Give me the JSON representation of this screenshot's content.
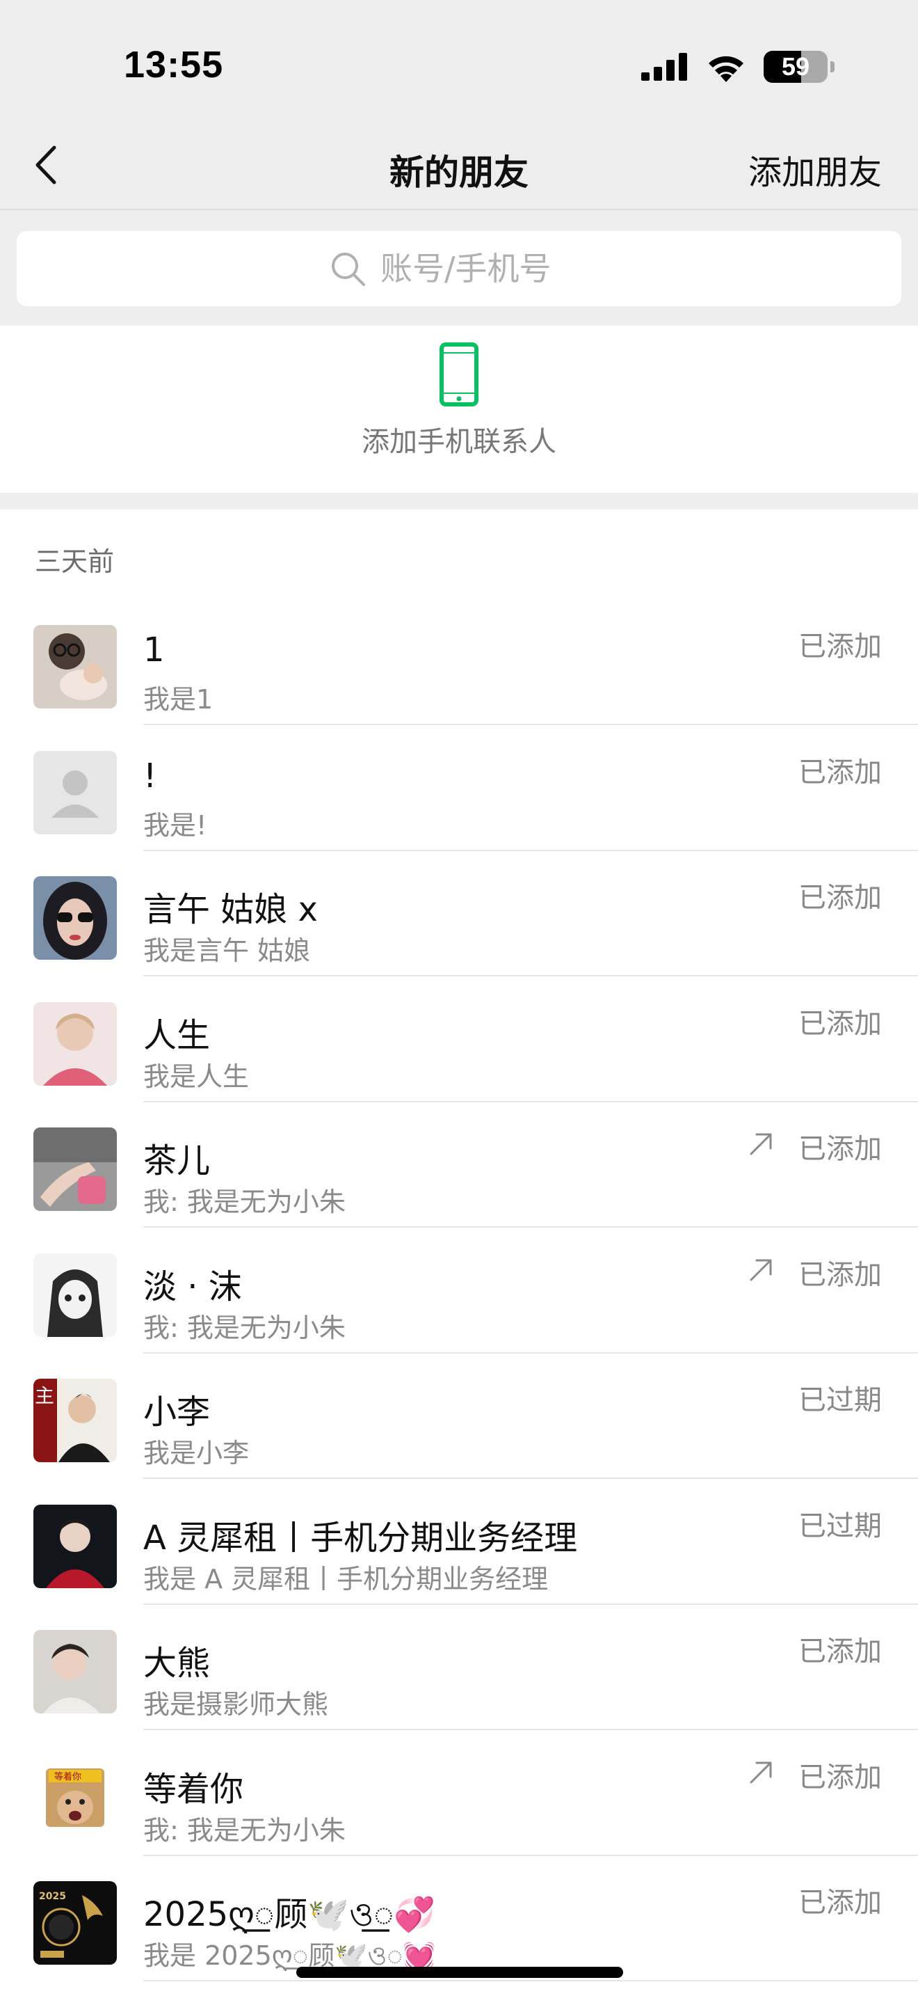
{
  "status_bar": {
    "time": "13:55",
    "battery_level": "59"
  },
  "nav": {
    "title": "新的朋友",
    "action": "添加朋友"
  },
  "search": {
    "placeholder": "账号/手机号"
  },
  "contacts_entry": {
    "label": "添加手机联系人"
  },
  "list": {
    "section_label": "三天前",
    "items": [
      {
        "name": "1",
        "message": "我是1",
        "status": "已添加",
        "shared": false,
        "avatar": "photo-person-glasses"
      },
      {
        "name": "!",
        "message": "我是!",
        "status": "已添加",
        "shared": false,
        "avatar": "default-avatar"
      },
      {
        "name": "言午 姑娘 x",
        "message": "我是言午 姑娘",
        "status": "已添加",
        "shared": false,
        "avatar": "photo-woman-sunglasses"
      },
      {
        "name": "人生",
        "message": "我是人生",
        "status": "已添加",
        "shared": false,
        "avatar": "photo-woman-pink"
      },
      {
        "name": "茶儿",
        "message": "我: 我是无为小朱",
        "status": "已添加",
        "shared": true,
        "avatar": "photo-hand-pink-bag"
      },
      {
        "name": "淡 · 沫",
        "message": "我: 我是无为小朱",
        "status": "已添加",
        "shared": true,
        "avatar": "photo-anime-girl"
      },
      {
        "name": "小李",
        "message": "我是小李",
        "status": "已过期",
        "shared": false,
        "avatar": "photo-man-suit"
      },
      {
        "name": "A 灵犀租丨手机分期业务经理",
        "message": "我是 A 灵犀租丨手机分期业务经理",
        "status": "已过期",
        "shared": false,
        "avatar": "photo-red-jacket"
      },
      {
        "name": "大熊",
        "message": "我是摄影师大熊",
        "status": "已添加",
        "shared": false,
        "avatar": "photo-young-man"
      },
      {
        "name": "等着你",
        "message": "我: 我是无为小朱",
        "status": "已添加",
        "shared": true,
        "avatar": "photo-meme"
      },
      {
        "name": "2025ღ꯭顾🕊️ও꯭💞",
        "message": "我是 2025ღ꯭顾🕊️ও꯭💓",
        "status": "已添加",
        "shared": false,
        "avatar": "photo-gold-eagle"
      }
    ]
  },
  "colors": {
    "accent_green": "#07c160",
    "bg_gray": "#ededed"
  }
}
